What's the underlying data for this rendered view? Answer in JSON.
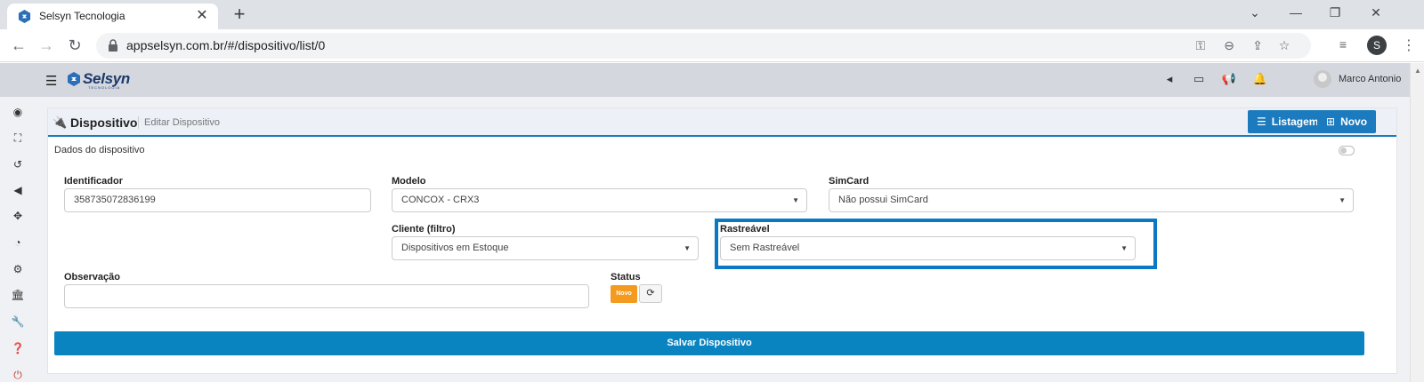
{
  "browser": {
    "tab_title": "Selsyn Tecnologia",
    "url": "appselsyn.com.br/#/dispositivo/list/0",
    "profile_initial": "S"
  },
  "topnav": {
    "logo_text": "Selsyn",
    "logo_sub": "TECNOLOGIA",
    "user_name": "Marco Antonio"
  },
  "card": {
    "title": "Dispositivo",
    "subtitle": "Editar Dispositivo",
    "listagem_label": "Listagem",
    "novo_label": "Novo",
    "section_label": "Dados do dispositivo"
  },
  "form": {
    "identificador": {
      "label": "Identificador",
      "value": "358735072836199"
    },
    "modelo": {
      "label": "Modelo",
      "value": "CONCOX - CRX3"
    },
    "simcard": {
      "label": "SimCard",
      "value": "Não possui SimCard"
    },
    "cliente": {
      "label": "Cliente (filtro)",
      "value": "Dispositivos em Estoque"
    },
    "rastreavel": {
      "label": "Rastreável",
      "value": "Sem Rastreável"
    },
    "observacao": {
      "label": "Observação",
      "value": ""
    },
    "status": {
      "label": "Status",
      "badge": "Novo"
    },
    "save_label": "Salvar Dispositivo"
  },
  "colors": {
    "primary": "#1c7bbf",
    "save": "#0a84c0",
    "status_badge": "#f39a1f",
    "highlight": "#0a78c2"
  }
}
